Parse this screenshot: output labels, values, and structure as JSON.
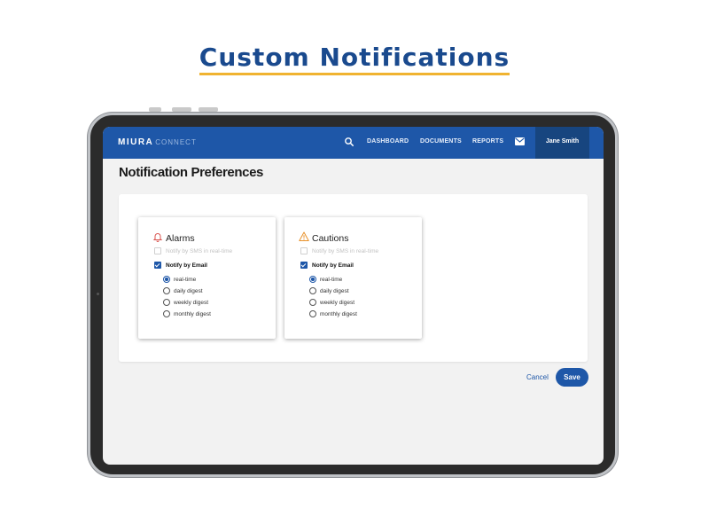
{
  "headline": "Custom Notifications",
  "app": {
    "logo": "MIURA",
    "logo_sub": "CONNECT",
    "nav": [
      "DASHBOARD",
      "DOCUMENTS",
      "REPORTS"
    ],
    "user_name": "Jane Smith"
  },
  "page_title": "Notification Preferences",
  "cards": [
    {
      "title": "Alarms",
      "icon": "bell-icon",
      "sms_label": "Notify by SMS in real-time",
      "sms_checked": false,
      "email_label": "Notify by Email",
      "email_checked": true,
      "options": [
        "real-time",
        "daily digest",
        "weekly digest",
        "monthly digest"
      ],
      "selected": "real-time"
    },
    {
      "title": "Cautions",
      "icon": "warning-icon",
      "sms_label": "Notify by SMS in real-time",
      "sms_checked": false,
      "email_label": "Notify by Email",
      "email_checked": true,
      "options": [
        "real-time",
        "daily digest",
        "weekly digest",
        "monthly digest"
      ],
      "selected": "real-time"
    }
  ],
  "actions": {
    "cancel": "Cancel",
    "save": "Save"
  },
  "colors": {
    "brand": "#1e57a8",
    "accent_underline": "#f0b330",
    "alarm_icon": "#d9534f",
    "caution_icon": "#e8922b"
  }
}
